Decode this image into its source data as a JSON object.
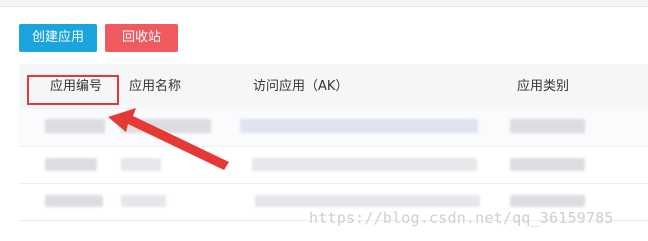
{
  "toolbar": {
    "create_label": "创建应用",
    "recycle_label": "回收站"
  },
  "table": {
    "columns": [
      "应用编号",
      "应用名称",
      "访问应用（AK）",
      "应用类别"
    ]
  },
  "watermark": "https://blog.csdn.net/qq_36159785",
  "colors": {
    "primary": "#1aa3dc",
    "danger": "#f05a5f",
    "annotation": "#e53935"
  }
}
